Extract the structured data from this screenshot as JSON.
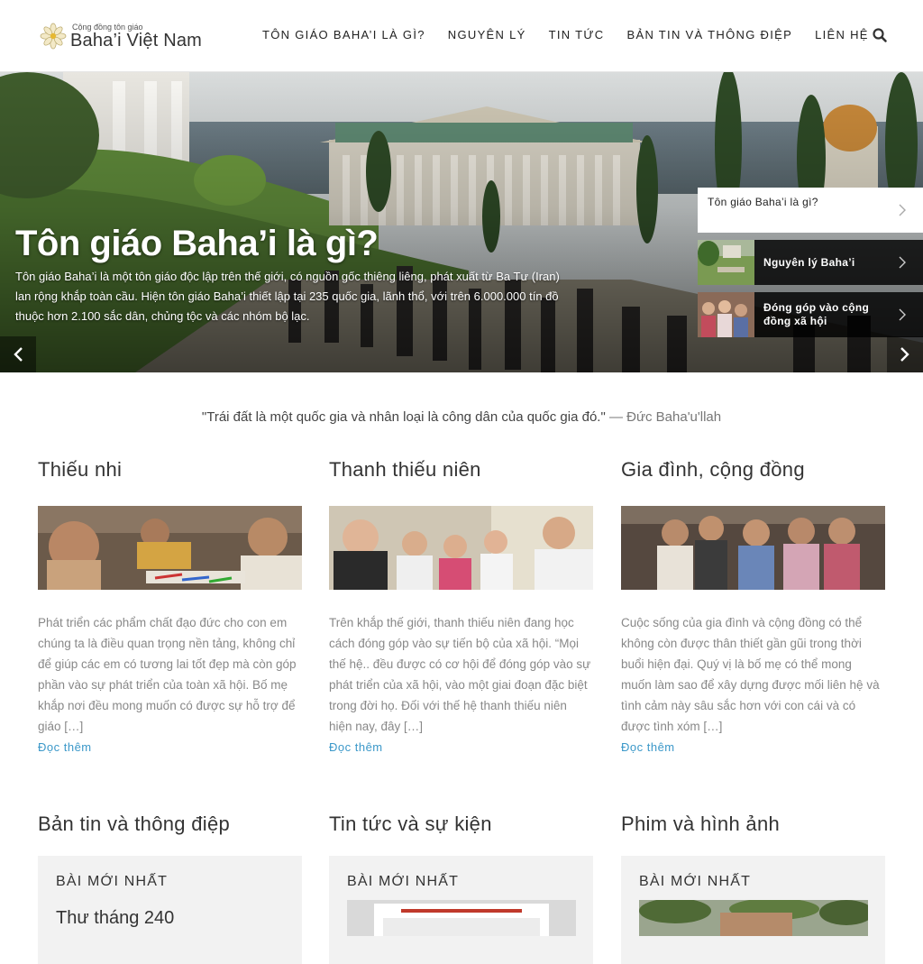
{
  "header": {
    "logo_small": "Cộng đồng tôn giáo",
    "logo_big": "Baha’i Việt Nam",
    "nav": [
      {
        "label": "Tôn giáo Baha’i là gì?"
      },
      {
        "label": "Nguyên lý"
      },
      {
        "label": "Tin tức"
      },
      {
        "label": "Bản tin và thông điệp"
      },
      {
        "label": "Liên hệ"
      }
    ],
    "search_icon": "search-icon"
  },
  "hero": {
    "title": "Tôn giáo Baha’i là gì?",
    "text": "Tôn giáo Baha’i là một tôn giáo độc lập trên thế giới, có nguồn gốc thiêng liêng, phát xuất từ Ba Tư (Iran) lan rộng khắp toàn cầu. Hiện tôn giáo Baha’i thiết lập tại 235 quốc gia, lãnh thổ, với trên 6.000.000 tín đồ thuộc hơn 2.100 sắc dân, chủng tộc và các nhóm bộ lạc.",
    "tabs": [
      {
        "label": "Tôn giáo Baha’i là gì?",
        "active": true
      },
      {
        "label": "Nguyên lý Baha’i",
        "active": false
      },
      {
        "label": "Đóng góp vào cộng đồng xã hội",
        "active": false
      }
    ]
  },
  "quote": {
    "text": "\"Trái đất là một quốc gia và nhân loại là công dân của quốc gia đó.\"",
    "author": " — Đức Baha'u'llah"
  },
  "columns": [
    {
      "title": "Thiếu nhi",
      "text": "Phát triển các phẩm chất đạo đức cho con em chúng ta là điều quan trọng nền tảng, không chỉ để giúp các em có tương lai tốt đẹp mà còn góp phần vào sự phát triển của toàn xã hội. Bố mẹ khắp nơi đều mong muốn có được sự hỗ trợ để giáo […]",
      "read_more": "Đọc thêm"
    },
    {
      "title": "Thanh thiếu niên",
      "text": "Trên khắp thế giới, thanh thiếu niên đang học cách đóng góp vào sự tiến bộ của xã hội. “Mọi thế hệ.. đều được có cơ hội để đóng góp vào sự phát triển của xã hội, vào một giai đoạn đặc biệt trong đời họ. Đối với thế hệ thanh thiếu niên hiện nay, đây […]",
      "read_more": "Đọc thêm"
    },
    {
      "title": "Gia đình, cộng đồng",
      "text": "Cuộc sống của gia đình và cộng đồng có thể không còn được thân thiết gần gũi trong thời buổi hiện đại. Quý vị là bố mẹ có thể mong muốn làm sao để xây dựng được mối liên hệ và tình cảm này sâu sắc hơn với con cái và có được tình xóm […]",
      "read_more": "Đọc thêm"
    }
  ],
  "news": [
    {
      "title": "Bản tin và thông điệp",
      "head": "Bài mới nhất",
      "item": "Thư tháng 240"
    },
    {
      "title": "Tin tức và sự kiện",
      "head": "Bài mới nhất"
    },
    {
      "title": "Phim và hình ảnh",
      "head": "Bài mới nhất"
    }
  ],
  "colors": {
    "link": "#3b98c9",
    "text_muted": "#888888",
    "news_bg": "#f2f2f2"
  }
}
